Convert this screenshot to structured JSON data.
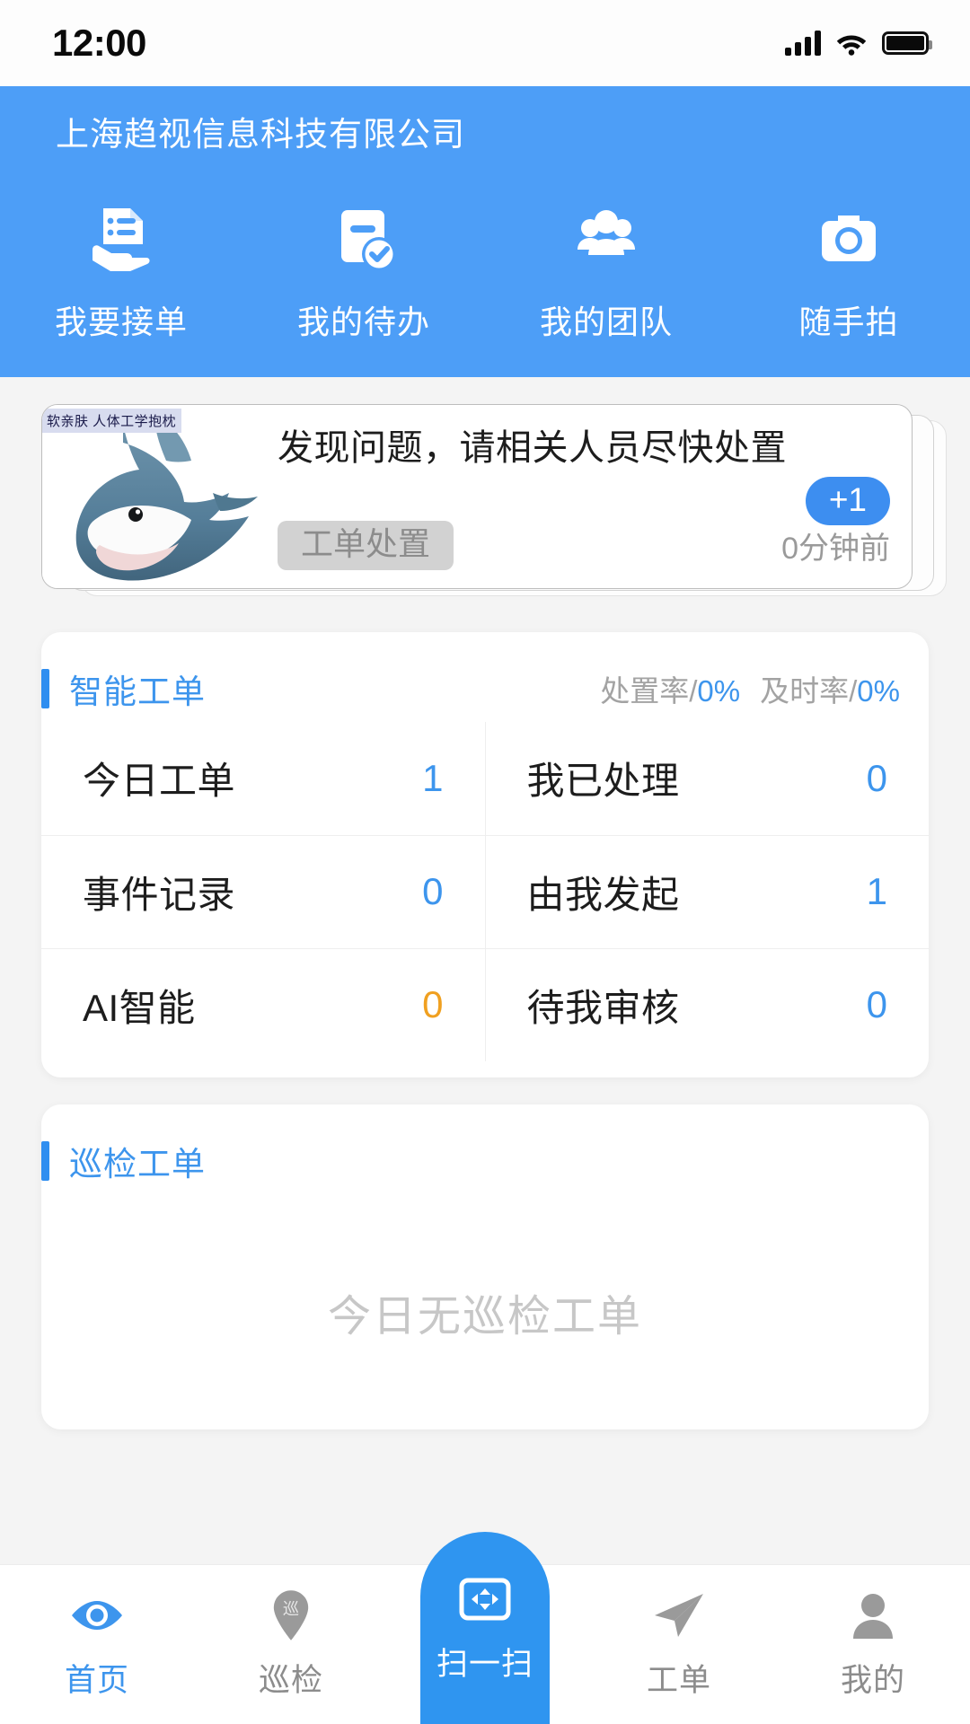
{
  "status_bar": {
    "time": "12:00",
    "signal_icon": "signal-bars-icon",
    "wifi_icon": "wifi-icon",
    "battery_icon": "battery-icon"
  },
  "header": {
    "company_name": "上海趋视信息科技有限公司",
    "accent_color": "#4d9ef7",
    "quick_actions": [
      {
        "label": "我要接单",
        "icon": "document-on-hand-icon"
      },
      {
        "label": "我的待办",
        "icon": "document-check-icon"
      },
      {
        "label": "我的团队",
        "icon": "people-group-icon"
      },
      {
        "label": "随手拍",
        "icon": "camera-icon"
      }
    ]
  },
  "notice": {
    "title": "发现问题，请相关人员尽快处置",
    "badge": "+1",
    "tag": "工单处置",
    "time": "0分钟前",
    "thumb_watermark": "软亲肤 人体工学抱枕",
    "thumb_icon": "shark-plush-image",
    "stacked_cards": 3
  },
  "smart_order": {
    "title": "智能工单",
    "rates": [
      {
        "label": "处置率/",
        "value": "0%"
      },
      {
        "label": "及时率/",
        "value": "0%"
      }
    ],
    "rows": [
      [
        {
          "label": "今日工单",
          "value": "1",
          "color": "#3d95ed"
        },
        {
          "label": "我已处理",
          "value": "0",
          "color": "#3d95ed"
        }
      ],
      [
        {
          "label": "事件记录",
          "value": "0",
          "color": "#3d95ed"
        },
        {
          "label": "由我发起",
          "value": "1",
          "color": "#3d95ed"
        }
      ],
      [
        {
          "label": "AI智能",
          "value": "0",
          "color": "#f0a020"
        },
        {
          "label": "待我审核",
          "value": "0",
          "color": "#3d95ed"
        }
      ]
    ]
  },
  "inspection": {
    "title": "巡检工单",
    "empty_text": "今日无巡检工单"
  },
  "tabbar": {
    "items": [
      {
        "label": "首页",
        "icon": "eye-icon",
        "active": true
      },
      {
        "label": "巡检",
        "icon": "map-pin-patrol-icon",
        "active": false
      },
      {
        "label": "工单",
        "icon": "paper-plane-icon",
        "active": false
      },
      {
        "label": "我的",
        "icon": "person-icon",
        "active": false
      }
    ],
    "scan": {
      "label": "扫一扫",
      "icon": "scan-frame-icon"
    }
  }
}
